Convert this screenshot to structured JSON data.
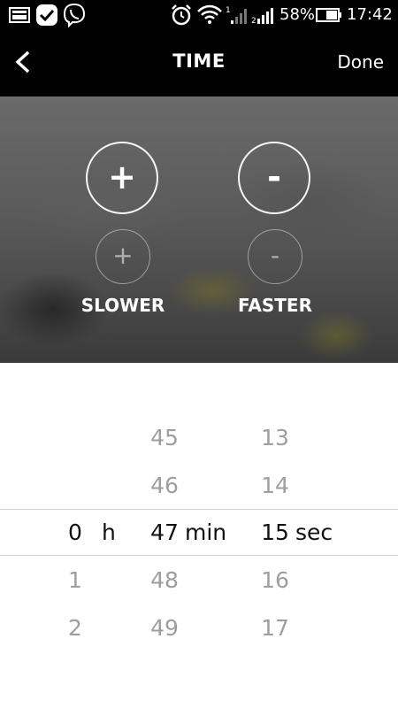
{
  "status_bar": {
    "battery": "58%",
    "time": "17:42",
    "icons": [
      "gallery-icon",
      "check-icon",
      "viber-icon",
      "alarm-icon",
      "wifi-icon",
      "signal-1-icon",
      "signal-2-icon",
      "battery-icon"
    ]
  },
  "header": {
    "back_label": "",
    "title": "TIME",
    "done_label": "Done"
  },
  "controls": {
    "slower_label": "SLOWER",
    "faster_label": "FASTER",
    "plus_big": "+",
    "minus_big": "-",
    "plus_small": "+",
    "minus_small": "-"
  },
  "picker": {
    "hours": {
      "above": [
        "",
        ""
      ],
      "selected": "0",
      "unit": "h",
      "below": [
        "1",
        "2"
      ]
    },
    "minutes": {
      "above": [
        "45",
        "46"
      ],
      "selected": "47",
      "unit": "min",
      "below": [
        "48",
        "49"
      ]
    },
    "seconds": {
      "above": [
        "13",
        "14"
      ],
      "selected": "15",
      "unit": "sec",
      "below": [
        "16",
        "17"
      ]
    }
  }
}
